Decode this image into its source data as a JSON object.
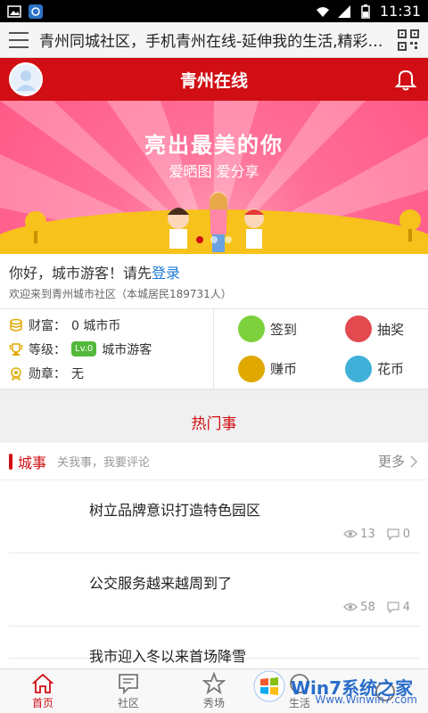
{
  "status_bar": {
    "time": "11:31",
    "left_icons": [
      "image-icon",
      "app-icon"
    ],
    "right_icons": [
      "wifi-icon",
      "signal-icon",
      "battery-icon"
    ]
  },
  "browser": {
    "title": "青州同城社区，手机青州在线-延伸我的生活,精彩我..."
  },
  "header": {
    "app_title": "青州在线"
  },
  "banner": {
    "headline": "亮出最美的你",
    "subtext": "爱晒图 爱分享",
    "dots_total": 3,
    "active_dot": 0
  },
  "welcome": {
    "greeting_prefix": "你好，城市游客！请先",
    "login_link": "登录",
    "note": "欢迎来到青州城市社区（本城居民189731人）"
  },
  "stats": {
    "wealth_label": "财富：",
    "wealth_value": "0 城市币",
    "level_label": "等级：",
    "level_badge": "Lv.0",
    "level_name": "城市游客",
    "medal_label": "勋章：",
    "medal_value": "无"
  },
  "actions": [
    {
      "label": "签到",
      "color": "#7dd13d"
    },
    {
      "label": "抽奖",
      "color": "#e24a4f"
    },
    {
      "label": "赚币",
      "color": "#e0a900"
    },
    {
      "label": "花币",
      "color": "#3fb1d8"
    }
  ],
  "hot_section": {
    "title": "热门事"
  },
  "category_tab": {
    "label": "城事",
    "desc": "关我事，我要评论",
    "more": "更多"
  },
  "news": [
    {
      "title": "树立品牌意识打造特色园区",
      "views": "13",
      "comments": "0"
    },
    {
      "title": "公交服务越来越周到了",
      "views": "58",
      "comments": "4"
    },
    {
      "title": "我市迎入冬以来首场降雪",
      "views": "",
      "comments": ""
    }
  ],
  "bottom_nav": [
    {
      "label": "首页",
      "active": true
    },
    {
      "label": "社区",
      "active": false
    },
    {
      "label": "秀场",
      "active": false
    },
    {
      "label": "生活",
      "active": false
    },
    {
      "label": "",
      "active": false
    }
  ],
  "watermark": {
    "text": "Win7系统之家",
    "site": "Www.Winwin7.com"
  },
  "colors": {
    "brand_red": "#d10e13",
    "link_blue": "#1e7bd6"
  }
}
